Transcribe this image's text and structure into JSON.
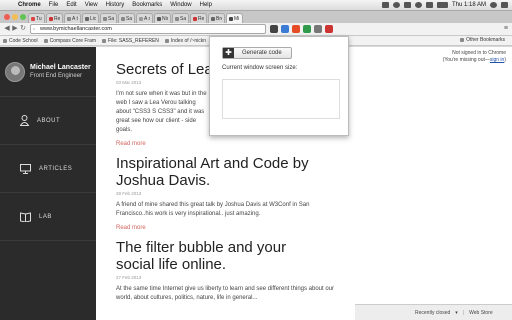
{
  "menubar": {
    "app_name": "Chrome",
    "items": [
      "File",
      "Edit",
      "View",
      "History",
      "Bookmarks",
      "Window",
      "Help"
    ],
    "clock": "Thu 1:18 AM"
  },
  "tabs": [
    {
      "label": "Tuts",
      "color": "#d44"
    },
    {
      "label": "Resp",
      "color": "#c33"
    },
    {
      "label": "A tal",
      "color": "#888"
    },
    {
      "label": "Lion",
      "color": "#666"
    },
    {
      "label": "Safa",
      "color": "#888"
    },
    {
      "label": "Safa",
      "color": "#888"
    },
    {
      "label": "A sir",
      "color": "#999"
    },
    {
      "label": "Nico",
      "color": "#555"
    },
    {
      "label": "Safa",
      "color": "#888"
    },
    {
      "label": "Resp",
      "color": "#c33"
    },
    {
      "label": "Brea",
      "color": "#666"
    },
    {
      "label": "Mi",
      "color": "#444"
    }
  ],
  "toolbar": {
    "url": "www.bymichaellancaster.com"
  },
  "bookmarks": {
    "items": [
      "Code School",
      "Compass Core Fram",
      "File: SASS_REFEREN",
      "Index of /~nickn"
    ],
    "other": "Other Bookmarks"
  },
  "sidebar": {
    "name": "Michael Lancaster",
    "role": "Front End Engineer",
    "nav": [
      {
        "label": "ABOUT",
        "icon": "person-icon"
      },
      {
        "label": "ARTICLES",
        "icon": "monitor-icon"
      },
      {
        "label": "LAB",
        "icon": "book-icon"
      }
    ]
  },
  "posts": [
    {
      "title": "Secrets of Lea",
      "date": "03 Mar 2013",
      "excerpt": "I'm not sure when it was but in the web I saw a Lea Verou talking about \"CSS3 S CSS3\" and it was great see how our client - side goals.",
      "readmore": "Read more"
    },
    {
      "title": "Inspirational Art and Code by Joshua Davis.",
      "date": "28 Feb 2013",
      "excerpt": "A friend of mine shared this great talk by Joshua Davis at W3Conf in San Francisco..his work is very inspirational.. just amazing.",
      "readmore": "Read more"
    },
    {
      "title": "The filter bubble and your social life online.",
      "date": "27 Feb 2013",
      "excerpt": "At the same time Internet give us liberty to learn and see different things about our world, about cultures, politics, nature, life in general...",
      "readmore": ""
    }
  ],
  "popup": {
    "button": "Generate code",
    "label": "Current window screen size:"
  },
  "right_pane": {
    "signin_line1": "Not signed in to Chrome",
    "signin_line2": "(You're missing out—",
    "signin_link": "sign in",
    "signin_end": ")"
  },
  "statusbar": {
    "recently_closed": "Recently closed",
    "web_store": "Web Store"
  },
  "colors": {
    "sidebar_bg": "#2b2b2b",
    "readmore": "#d0665f"
  }
}
